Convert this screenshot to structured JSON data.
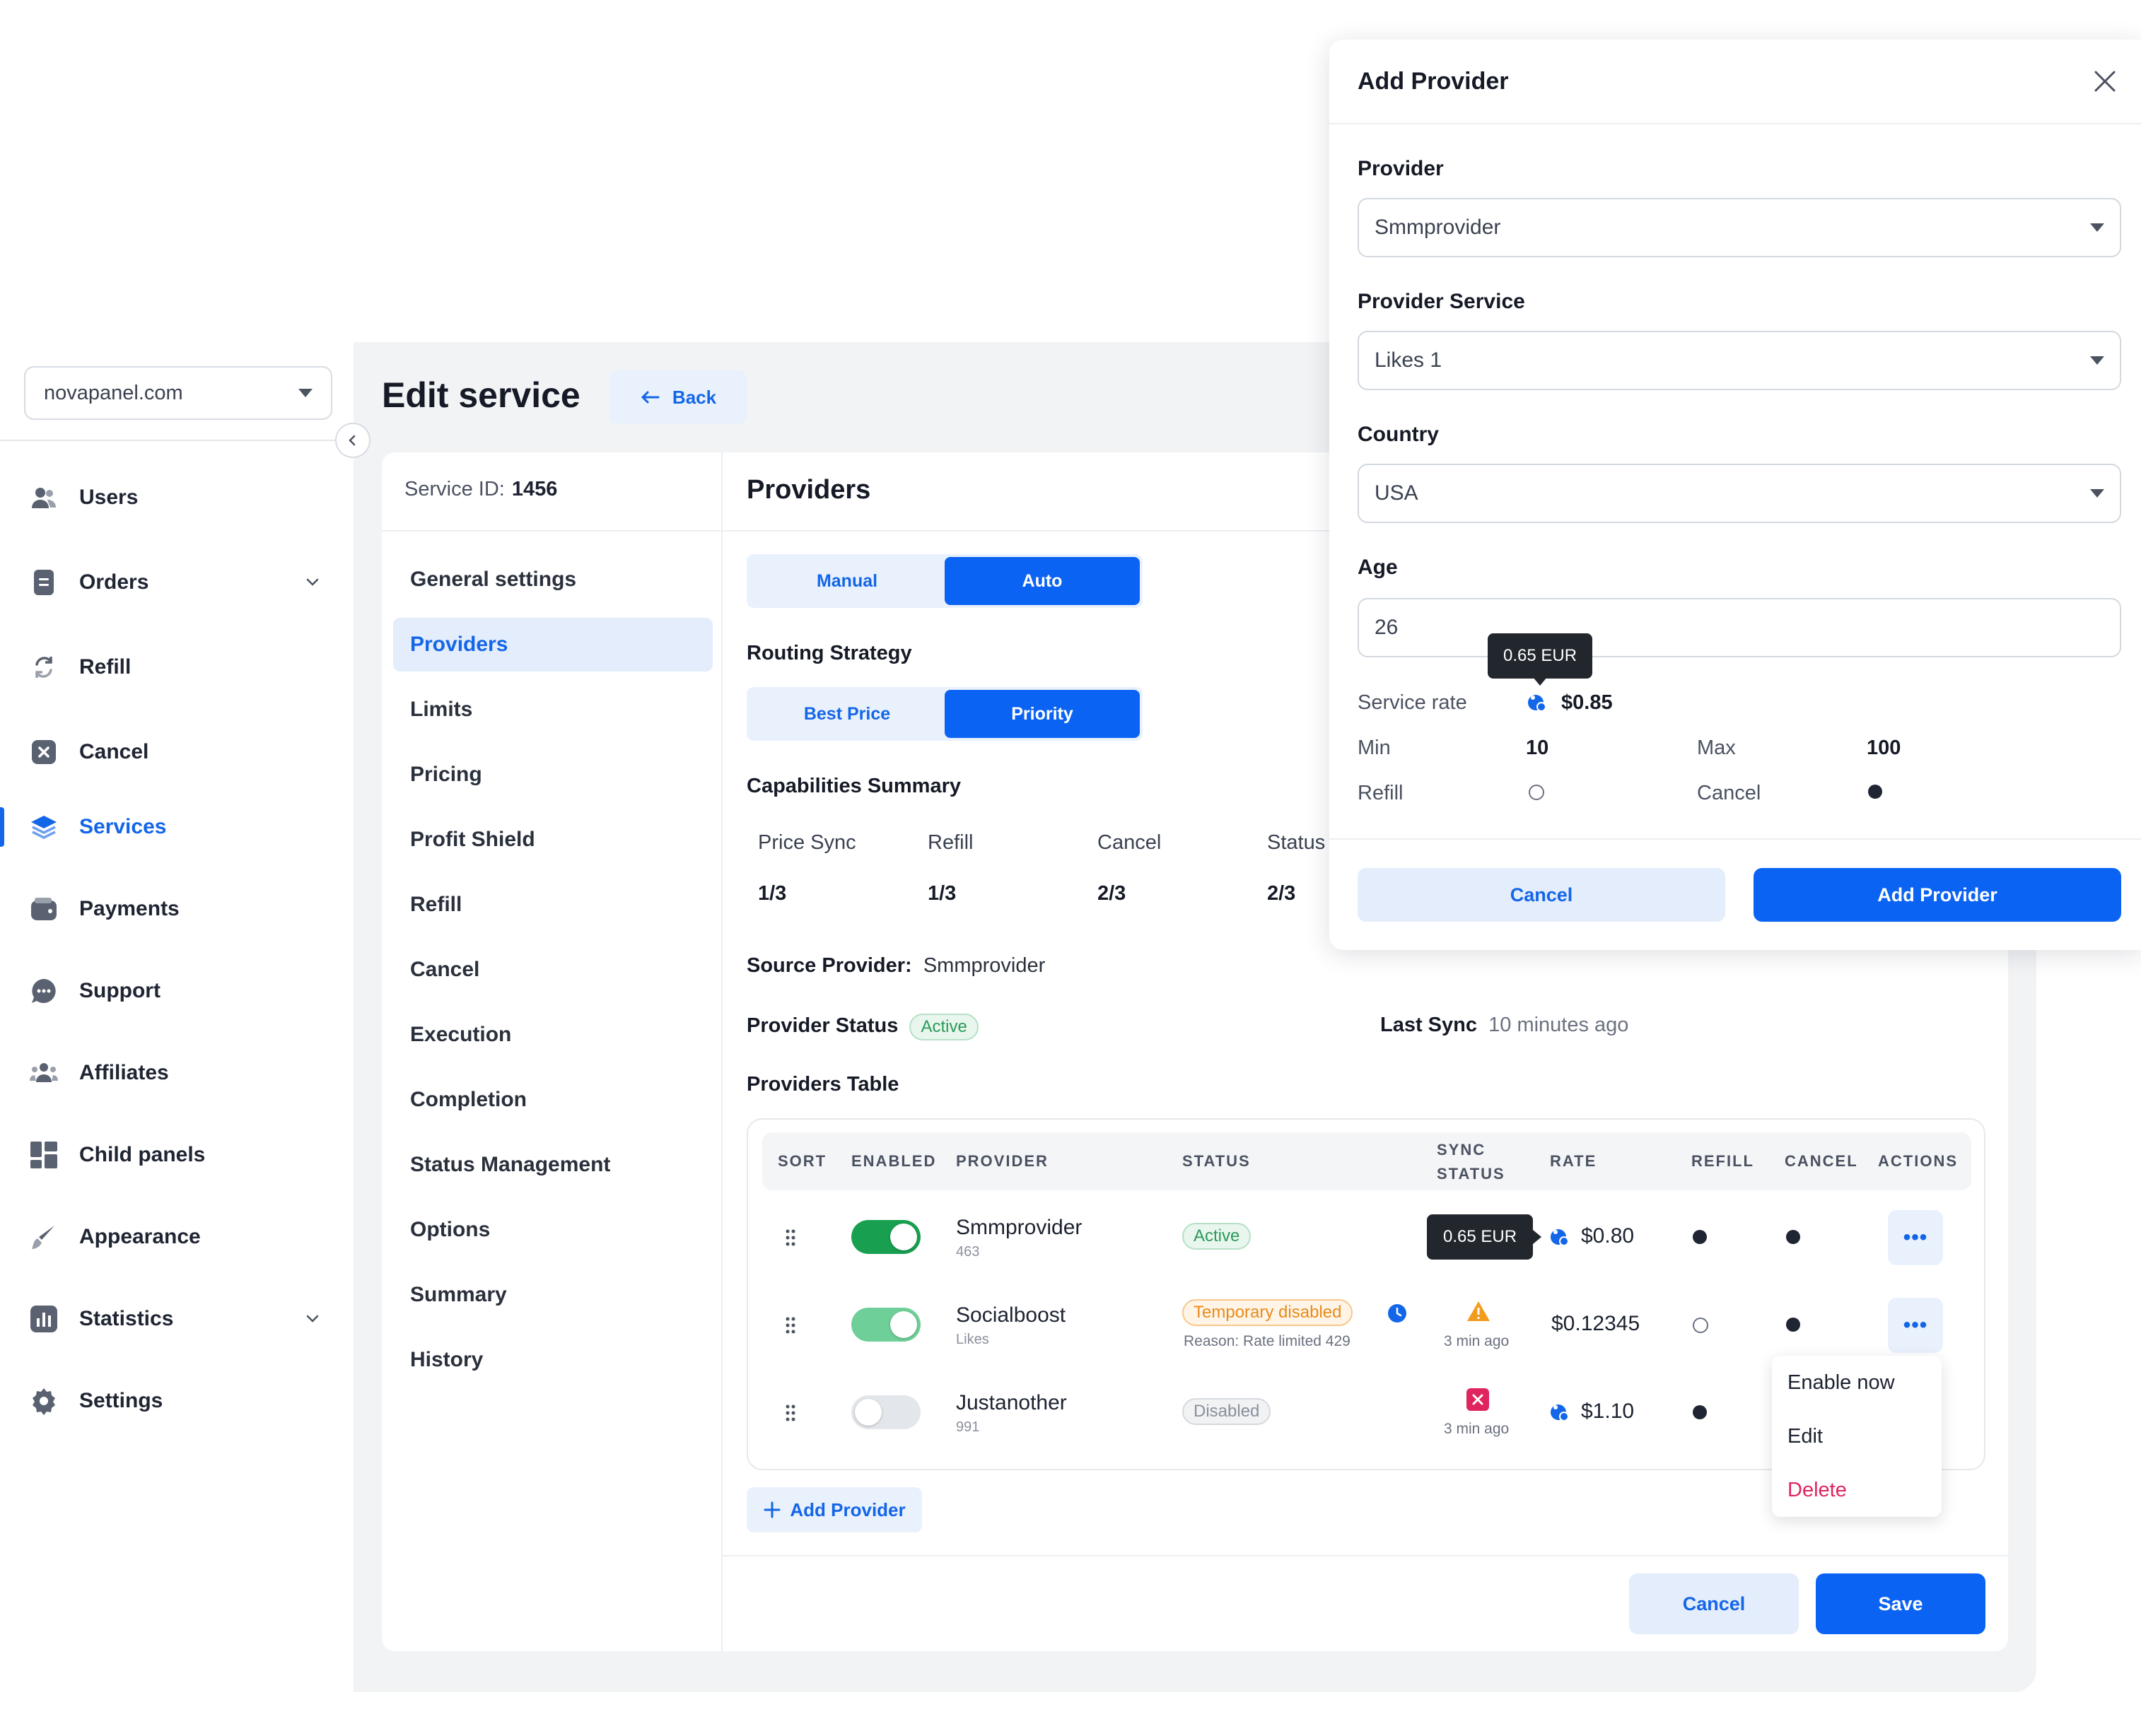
{
  "sidebar": {
    "domain": "novapanel.com",
    "items": [
      {
        "label": "Users",
        "icon": "users-icon"
      },
      {
        "label": "Orders",
        "icon": "document-icon"
      },
      {
        "label": "Refill",
        "icon": "refresh-icon"
      },
      {
        "label": "Cancel",
        "icon": "cancel-square-icon"
      },
      {
        "label": "Services",
        "icon": "layers-icon"
      },
      {
        "label": "Payments",
        "icon": "wallet-icon"
      },
      {
        "label": "Support",
        "icon": "chat-icon"
      },
      {
        "label": "Affiliates",
        "icon": "group-icon"
      },
      {
        "label": "Child panels",
        "icon": "grid-icon"
      },
      {
        "label": "Appearance",
        "icon": "brush-icon"
      },
      {
        "label": "Statistics",
        "icon": "bar-chart-icon"
      },
      {
        "label": "Settings",
        "icon": "gear-icon"
      }
    ],
    "active": "Services"
  },
  "page": {
    "title": "Edit service",
    "back_label": "Back",
    "service_id_label": "Service ID:",
    "service_id": "1456"
  },
  "menu": [
    "General settings",
    "Providers",
    "Limits",
    "Pricing",
    "Profit Shield",
    "Refill",
    "Cancel",
    "Execution",
    "Completion",
    "Status Management",
    "Options",
    "Summary",
    "History"
  ],
  "providers": {
    "heading": "Providers",
    "mode_tabs": [
      "Manual",
      "Auto"
    ],
    "routing_label": "Routing Strategy",
    "routing_tabs": [
      "Best Price",
      "Priority"
    ],
    "capabilities_label": "Capabilities Summary",
    "capabilities": [
      {
        "name": "Price Sync",
        "value": "1/3"
      },
      {
        "name": "Refill",
        "value": "1/3"
      },
      {
        "name": "Cancel",
        "value": "2/3"
      },
      {
        "name": "Status",
        "value": "2/3"
      }
    ],
    "source_label": "Source Provider:",
    "source_value": "Smmprovider",
    "status_label": "Provider Status",
    "status_value": "Active",
    "last_sync_label": "Last Sync",
    "last_sync_value": "10 minutes ago",
    "table_label": "Providers Table",
    "columns": [
      "SORT",
      "ENABLED",
      "PROVIDER",
      "STATUS",
      "SYNC",
      "STATUS",
      "RATE",
      "REFILL",
      "CANCEL",
      "ACTIONS"
    ],
    "rows": [
      {
        "name": "Smmprovider",
        "sub": "463",
        "status": "Active",
        "rate": "$0.80",
        "tooltip": "0.65 EUR",
        "sync_time": "",
        "enabled": true
      },
      {
        "name": "Socialboost",
        "sub": "Likes",
        "status": "Temporary disabled",
        "reason": "Reason: Rate limited 429",
        "sync_time": "3 min ago",
        "rate": "$0.12345",
        "enabled": true
      },
      {
        "name": "Justanother",
        "sub": "991",
        "status": "Disabled",
        "sync_time": "3 min ago",
        "rate": "$1.10",
        "enabled": false
      }
    ],
    "dropdown": [
      "Enable now",
      "Edit",
      "Delete"
    ],
    "add_provider_label": "Add Provider",
    "colors": {
      "accent": "#0b63f3",
      "toggle_on": "#18a050",
      "toggle_soft": "#6fcf98",
      "danger": "#e0245e"
    }
  },
  "footer": {
    "cancel": "Cancel",
    "save": "Save"
  },
  "modal": {
    "title": "Add Provider",
    "provider_label": "Provider",
    "provider_value": "Smmprovider",
    "service_label": "Provider Service",
    "service_value": "Likes 1",
    "country_label": "Country",
    "country_value": "USA",
    "age_label": "Age",
    "age_value": "26",
    "tooltip": "0.65 EUR",
    "rate_label": "Service rate",
    "rate_value": "$0.85",
    "min_label": "Min",
    "min_value": "10",
    "max_label": "Max",
    "max_value": "100",
    "refill_label": "Refill",
    "cancel_label": "Cancel",
    "cancel_btn": "Cancel",
    "add_btn": "Add Provider"
  }
}
